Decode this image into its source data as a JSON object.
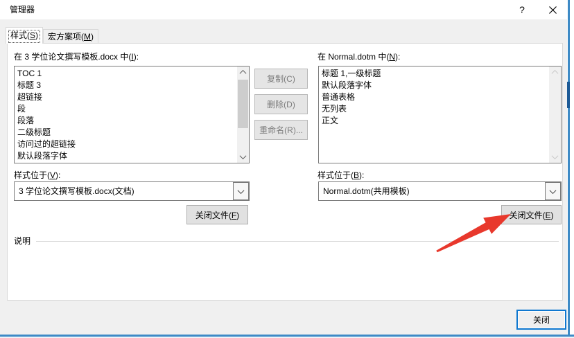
{
  "window": {
    "title": "管理器",
    "help_icon": "?",
    "close_icon": "close"
  },
  "tabs": [
    {
      "label": "样式(S)",
      "selected": true
    },
    {
      "label": "宏方案项(M)",
      "selected": false
    }
  ],
  "left_panel": {
    "list_label": "在 3 学位论文撰写模板.docx 中(I):",
    "items": [
      "TOC 1",
      "标题 3",
      "超链接",
      "段",
      "段落",
      "二级标题",
      "访问过的超链接",
      "默认段落字体"
    ],
    "combo_label": "样式位于(V):",
    "combo_value": "3 学位论文撰写模板.docx(文档)",
    "close_file_button": "关闭文件(F)"
  },
  "middle_buttons": [
    {
      "label": "复制(C)",
      "enabled": false
    },
    {
      "label": "删除(D)",
      "enabled": false
    },
    {
      "label": "重命名(R)...",
      "enabled": false
    }
  ],
  "right_panel": {
    "list_label": "在 Normal.dotm 中(N):",
    "items": [
      "标题 1,一级标题",
      "默认段落字体",
      "普通表格",
      "无列表",
      "正文"
    ],
    "combo_label": "样式位于(B):",
    "combo_value": "Normal.dotm(共用模板)",
    "close_file_button": "关闭文件(E)"
  },
  "description": {
    "label": "说明",
    "text": ""
  },
  "footer": {
    "close_button": "关闭"
  },
  "colors": {
    "accent": "#0f78d0",
    "arrow_red": "#e8382c",
    "dialog_bg": "#f0f0f0",
    "edge_blue": "#3d8ac6"
  }
}
